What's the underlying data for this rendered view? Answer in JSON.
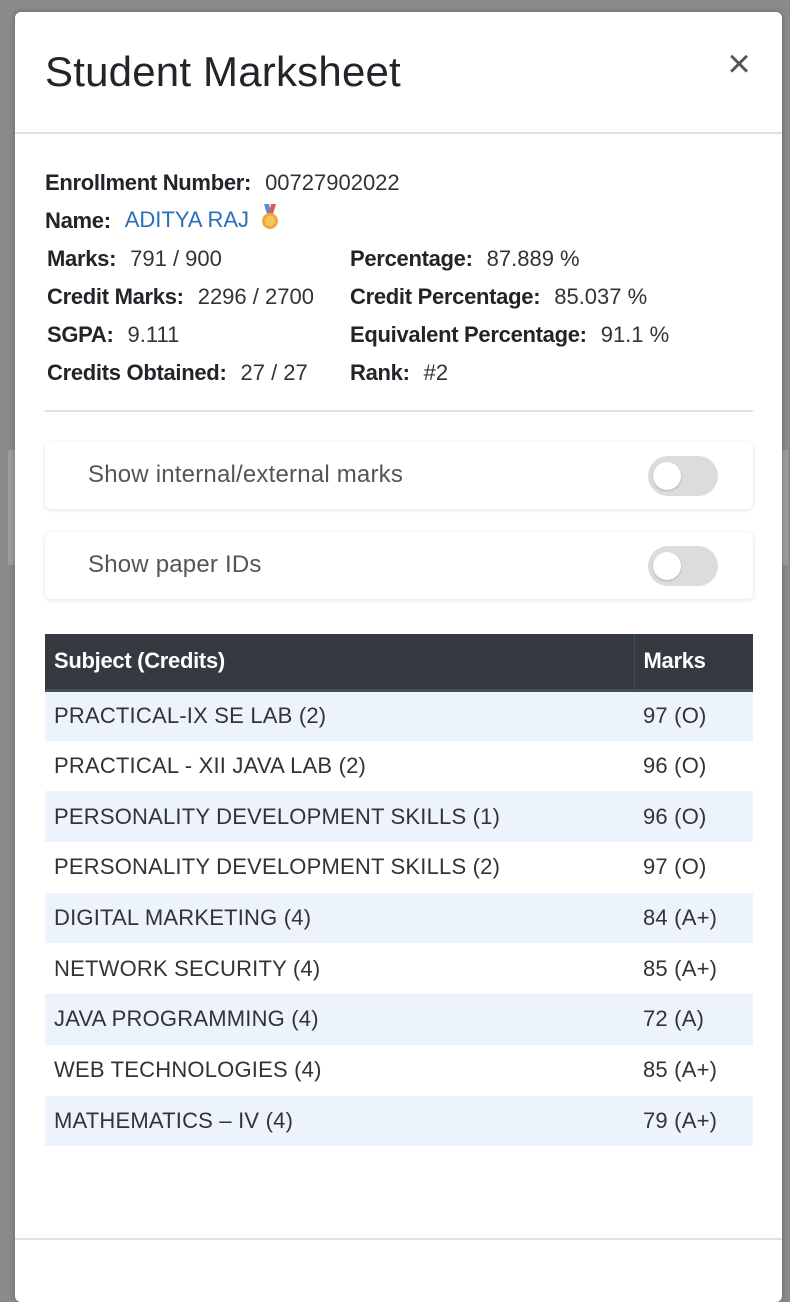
{
  "modal": {
    "title": "Student Marksheet",
    "close_label": "×"
  },
  "student": {
    "enrollment_label": "Enrollment Number:",
    "enrollment_value": "00727902022",
    "name_label": "Name:",
    "name_value": "ADITYA RAJ",
    "name_badge_icon": "medal-icon",
    "marks_label": "Marks:",
    "marks_value": "791 / 900",
    "percentage_label": "Percentage:",
    "percentage_value": "87.889 %",
    "credit_marks_label": "Credit Marks:",
    "credit_marks_value": "2296 / 2700",
    "credit_percentage_label": "Credit Percentage:",
    "credit_percentage_value": "85.037 %",
    "sgpa_label": "SGPA:",
    "sgpa_value": "9.111",
    "equivalent_label": "Equivalent Percentage:",
    "equivalent_value": "91.1 %",
    "credits_label": "Credits Obtained:",
    "credits_value": "27 / 27",
    "rank_label": "Rank:",
    "rank_value": "#2"
  },
  "toggles": [
    {
      "label": "Show internal/external marks",
      "on": false
    },
    {
      "label": "Show paper IDs",
      "on": false
    }
  ],
  "table": {
    "headers": [
      "Subject (Credits)",
      "Marks"
    ],
    "rows": [
      [
        "PRACTICAL-IX SE LAB (2)",
        "97 (O)"
      ],
      [
        "PRACTICAL - XII JAVA LAB (2)",
        "96 (O)"
      ],
      [
        "PERSONALITY DEVELOPMENT SKILLS (1)",
        "96 (O)"
      ],
      [
        "PERSONALITY DEVELOPMENT SKILLS (2)",
        "97 (O)"
      ],
      [
        "DIGITAL MARKETING (4)",
        "84 (A+)"
      ],
      [
        "NETWORK SECURITY (4)",
        "85 (A+)"
      ],
      [
        "JAVA PROGRAMMING (4)",
        "72 (A)"
      ],
      [
        "WEB TECHNOLOGIES (4)",
        "85 (A+)"
      ],
      [
        "MATHEMATICS – IV (4)",
        "79 (A+)"
      ]
    ]
  },
  "colors": {
    "header_bg": "#343a40",
    "stripe_bg": "#ecf3fc",
    "name_link": "#2a6fb8"
  }
}
